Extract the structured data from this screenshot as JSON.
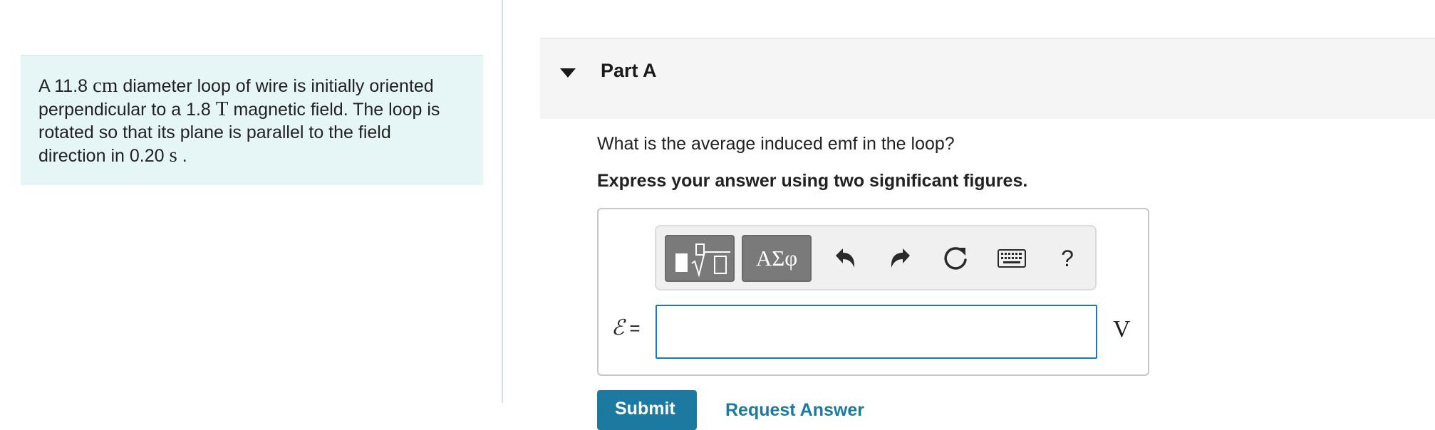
{
  "problem": {
    "text_1": "A 11.8 ",
    "unit_cm": "cm",
    "text_2": " diameter loop of wire is initially oriented perpendicular to a 1.8 ",
    "unit_T": "T",
    "text_3": " magnetic field. The loop is rotated so that its plane is parallel to the field direction in 0.20 ",
    "unit_s": "s",
    "text_4": " ."
  },
  "part": {
    "title": "Part A",
    "question": "What is the average induced emf in the loop?",
    "instruction": "Express your answer using two significant figures."
  },
  "toolbar": {
    "greek_label": "ΑΣφ",
    "help_label": "?",
    "icons": [
      "templates-icon",
      "undo-icon",
      "redo-icon",
      "reset-icon",
      "keyboard-icon",
      "help-icon"
    ]
  },
  "answer": {
    "symbol": "ℰ",
    "equals": " =",
    "value": "",
    "placeholder": "",
    "unit": "V"
  },
  "actions": {
    "submit_label": "Submit",
    "request_label": "Request Answer"
  },
  "colors": {
    "problem_bg": "#e6f5f6",
    "accent": "#1c7aa0",
    "input_border": "#1f77b4",
    "toolbar_button": "#7a7a7a"
  }
}
